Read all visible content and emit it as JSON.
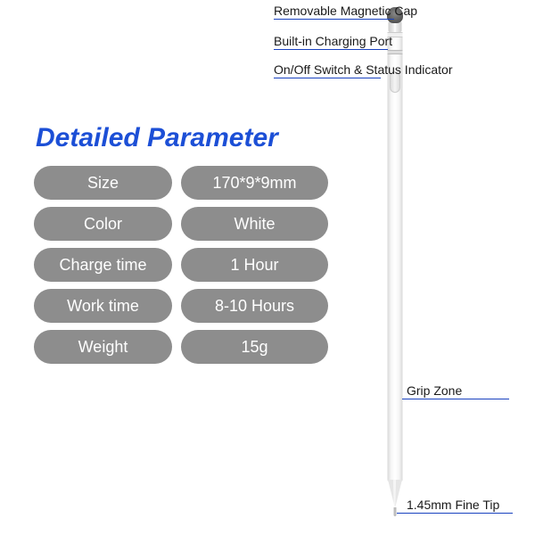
{
  "title": "Detailed Parameter",
  "specs": [
    {
      "label": "Size",
      "value": "170*9*9mm"
    },
    {
      "label": "Color",
      "value": "White"
    },
    {
      "label": "Charge time",
      "value": "1 Hour"
    },
    {
      "label": "Work time",
      "value": "8-10 Hours"
    },
    {
      "label": "Weight",
      "value": "15g"
    }
  ],
  "callouts": {
    "cap": "Removable Magnetic Cap",
    "port": "Built-in Charging Port",
    "switch": "On/Off Switch & Status Indicator",
    "grip": "Grip Zone",
    "tip": "1.45mm Fine Tip"
  }
}
